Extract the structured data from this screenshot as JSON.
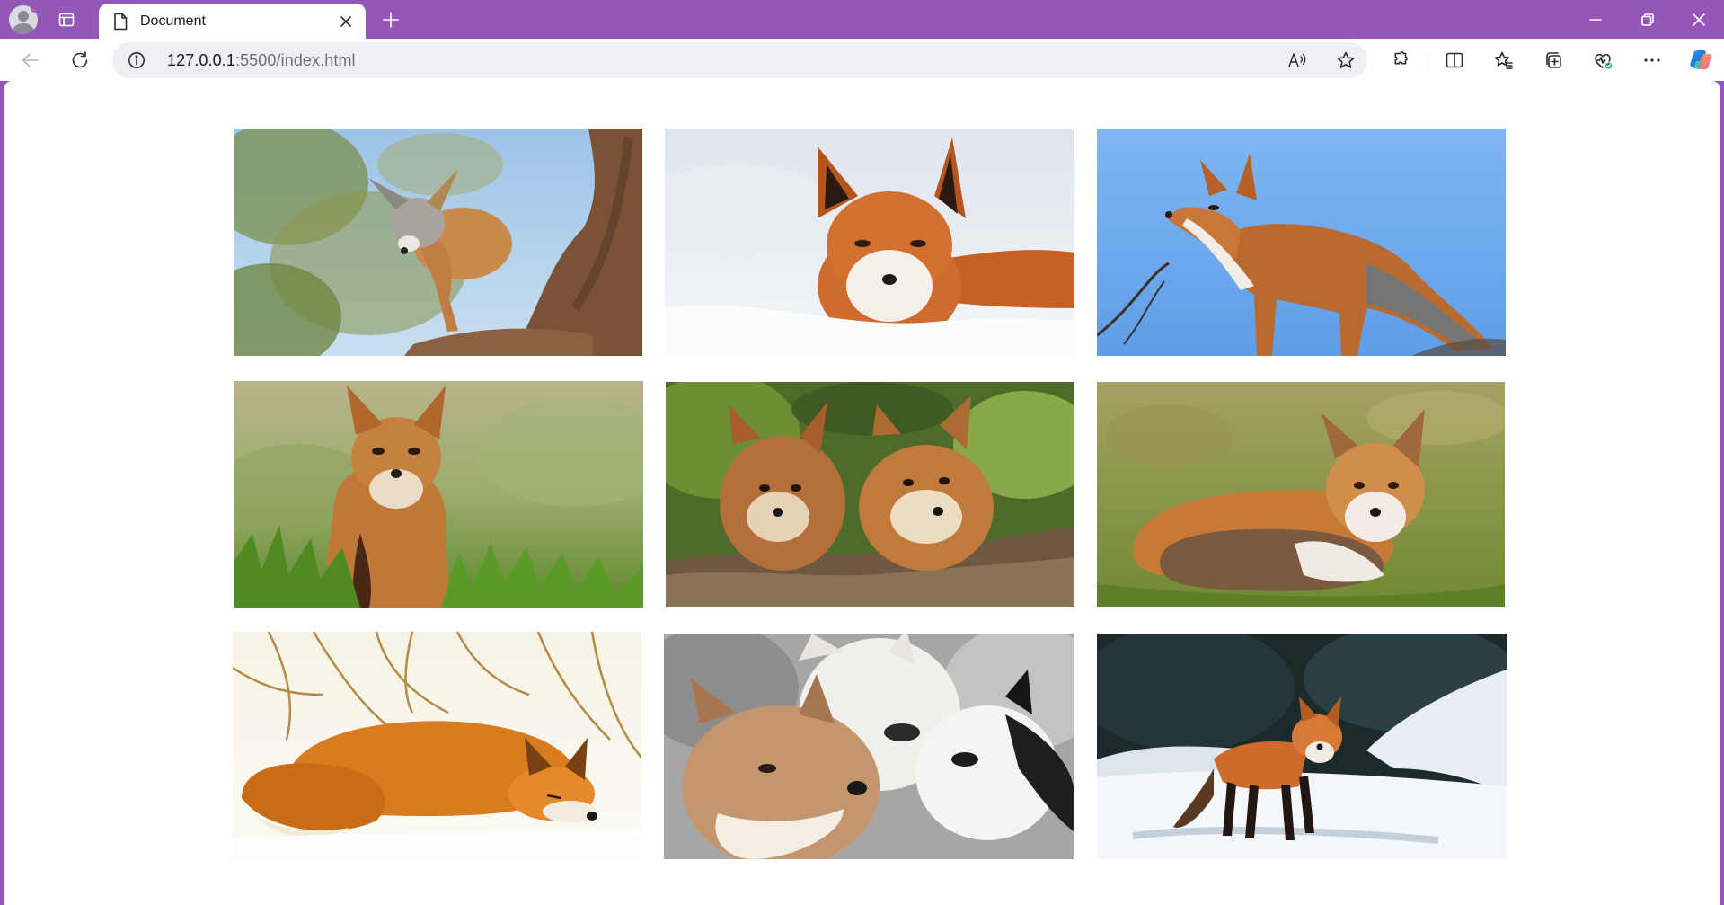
{
  "browser": {
    "tab": {
      "title": "Document",
      "icon": "page-icon"
    },
    "address": {
      "host": "127.0.0.1",
      "path": ":5500/index.html",
      "readaloud_glyph": "A⁵"
    },
    "toolbar_icons": [
      "back-icon",
      "refresh-icon",
      "info-icon",
      "read-aloud-icon",
      "star-icon",
      "extensions-icon",
      "split-screen-icon",
      "favorites-icon",
      "collections-icon",
      "browser-essentials-icon",
      "more-icon",
      "copilot-icon"
    ],
    "colors": {
      "frame": "#9457b9",
      "tab": "#ffffff",
      "omnibox": "#f1eef4"
    }
  },
  "gallery": {
    "images": [
      {
        "subject": "fox on a tree trunk",
        "scene": "sky-tree"
      },
      {
        "subject": "red fox lying in snow",
        "scene": "snow"
      },
      {
        "subject": "red fox standing against blue sky",
        "scene": "sky"
      },
      {
        "subject": "fox kit sitting in grass",
        "scene": "grass"
      },
      {
        "subject": "two fox kits",
        "scene": "kits"
      },
      {
        "subject": "fox curled on grass",
        "scene": "meadow"
      },
      {
        "subject": "fox sleeping in snow",
        "scene": "snow-sun"
      },
      {
        "subject": "three foxes close-up",
        "scene": "trio"
      },
      {
        "subject": "red fox walking in snow",
        "scene": "snow-forest"
      }
    ]
  }
}
